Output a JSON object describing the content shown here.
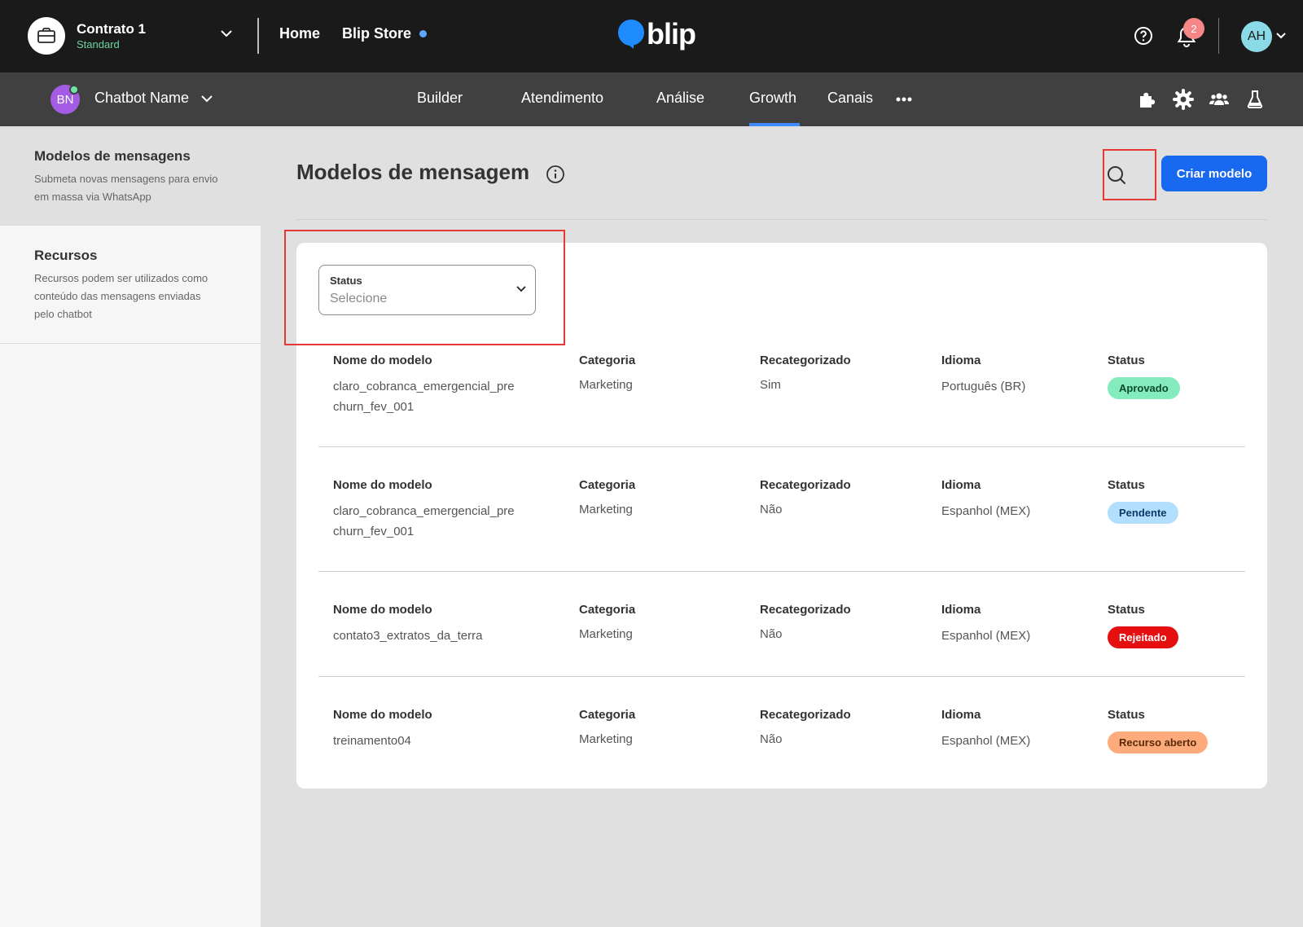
{
  "header": {
    "contract_name": "Contrato 1",
    "contract_plan": "Standard",
    "nav": [
      "Home",
      "Blip Store"
    ],
    "logo_text": "blip",
    "notifications_count": "2",
    "user_initials": "AH"
  },
  "subheader": {
    "bot_initials": "BN",
    "bot_name": "Chatbot Name",
    "tabs": [
      "Builder",
      "Atendimento",
      "Análise",
      "Growth",
      "Canais"
    ],
    "active_tab": "Growth"
  },
  "sidebar": {
    "items": [
      {
        "title": "Modelos de mensagens",
        "desc": "Submeta novas mensagens para envio em massa via WhatsApp"
      },
      {
        "title": "Recursos",
        "desc": "Recursos podem ser utilizados como conteúdo das mensagens enviadas pelo chatbot"
      }
    ]
  },
  "main": {
    "title": "Modelos de mensagem",
    "create_label": "Criar modelo",
    "filter": {
      "label": "Status",
      "placeholder": "Selecione"
    },
    "columns": [
      "Nome do modelo",
      "Categoria",
      "Recategorizado",
      "Idioma",
      "Status"
    ],
    "rows": [
      {
        "name": "claro_cobranca_emergencial_pre churn_fev_001",
        "category": "Marketing",
        "recategorized": "Sim",
        "language": "Português (BR)",
        "status": "Aprovado",
        "status_color": "#84ebbc",
        "status_text_color": "#0b4a2c"
      },
      {
        "name": "claro_cobranca_emergencial_pre churn_fev_001",
        "category": "Marketing",
        "recategorized": "Não",
        "language": "Espanhol (MEX)",
        "status": "Pendente",
        "status_color": "#b2dffd",
        "status_text_color": "#0b3a66"
      },
      {
        "name": "contato3_extratos_da_terra",
        "category": "Marketing",
        "recategorized": "Não",
        "language": "Espanhol (MEX)",
        "status": "Rejeitado",
        "status_color": "#e60f0f",
        "status_text_color": "#ffffff"
      },
      {
        "name": "treinamento04",
        "category": "Marketing",
        "recategorized": "Não",
        "language": "Espanhol (MEX)",
        "status": "Recurso aberto",
        "status_color": "#fdab7a",
        "status_text_color": "#5a2a08"
      }
    ]
  }
}
